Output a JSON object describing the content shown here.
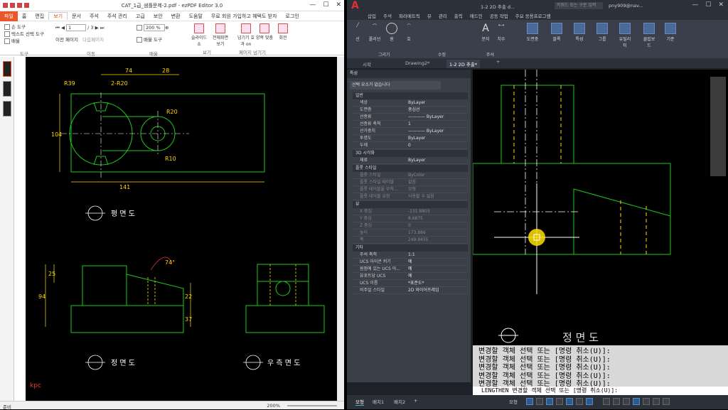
{
  "left_window": {
    "title": "CAT_1급_샘플문제-2.pdf - ezPDF Editor 3.0",
    "menu": {
      "file": "파일",
      "items": [
        "홈",
        "편집",
        "보기",
        "문서",
        "주석",
        "주석 관리",
        "고급",
        "보안",
        "변환",
        "도움말",
        "무료 회원 가입하고 혜택도 받자",
        "로그인"
      ]
    },
    "ribbon": {
      "hand": "손 도구",
      "text_select": "텍스트 선택 도구",
      "zoom_menu": "배율",
      "tools_group": "도구",
      "page_input": "1",
      "page_total": "/ 3",
      "prev_page": "이전 페이지",
      "next_page": "다음페이지",
      "move_group": "이동",
      "zoom_value": "200 %",
      "zoom_tool": "배율 도구",
      "zoom_group": "배율",
      "slideshow": "슬라이드쇼",
      "fullscreen": "전체화면 보기",
      "view_group": "보기",
      "page_view": "넘기기 효과 on",
      "page_group": "페이지 넘기기",
      "two_page": "양쪽 맞춤",
      "rotate": "회전"
    },
    "status": {
      "left": "준비",
      "zoom": "200%"
    }
  },
  "drawing_left": {
    "dims": {
      "d74": "74",
      "d28": "28",
      "r39": "R39",
      "r20a": "2-R20",
      "r20b": "R20",
      "r10": "R10",
      "d104": "104",
      "d141": "141",
      "d25": "25",
      "d94": "94",
      "d22": "22",
      "d37": "37",
      "a74": "74°"
    },
    "view_plan": "평 면 도",
    "view_front": "정 면 도",
    "view_side": "우 측 면 도",
    "logo": "kpc"
  },
  "right_window": {
    "title": "1-2 2D 추출 d...",
    "search": "키워드 또는 구문 입력",
    "user": "pny909@nav...",
    "badge": "909",
    "menu": [
      "삽입",
      "주석",
      "파라메트릭",
      "뷰",
      "관리",
      "출력",
      "애드인",
      "공동 작업",
      "주요 응용프로그램"
    ],
    "ribbon": {
      "line": "선",
      "polyline": "폴리선",
      "circle": "원",
      "arc": "호",
      "draw_group": "그리기",
      "modify_group": "수정",
      "text": "문자",
      "dimension": "치수",
      "annotate_group": "주석",
      "layer": "도면층",
      "block": "블록",
      "properties": "특성",
      "group": "그룹",
      "utilities": "유틸리티",
      "clipboard": "클립보드",
      "view": "기준"
    },
    "tabs": [
      "시작",
      "Drawing2*",
      "1-2 2D 추출*"
    ],
    "props": {
      "header": "특성",
      "selection": "선택 요소가 없습니다",
      "sections": [
        {
          "title": "일반",
          "rows": [
            [
              "색상",
              "ByLayer"
            ],
            [
              "도면층",
              "중심선"
            ],
            [
              "선종류",
              "———— ByLayer"
            ],
            [
              "선종류 축척",
              "1"
            ],
            [
              "선가중치",
              "———— ByLayer"
            ],
            [
              "투명도",
              "ByLayer"
            ],
            [
              "두께",
              "0"
            ]
          ]
        },
        {
          "title": "3D 시각화",
          "rows": [
            [
              "재료",
              "ByLayer"
            ]
          ]
        },
        {
          "title": "플롯 스타일",
          "rows": [
            [
              "플롯 스타일",
              "ByColor"
            ],
            [
              "플롯 스타일 테이블",
              "없음"
            ],
            [
              "플롯 테이블을 부착...",
              "모형"
            ],
            [
              "플롯 테이블 유형",
              "사용할 수 없음"
            ]
          ]
        },
        {
          "title": "뷰",
          "rows": [
            [
              "X 중심",
              "-131.8803"
            ],
            [
              "Y 중심",
              "8.6875"
            ],
            [
              "Z 중심",
              "0"
            ],
            [
              "높이",
              "173.886"
            ],
            [
              "폭",
              "249.9455"
            ]
          ]
        },
        {
          "title": "기타",
          "rows": [
            [
              "주석 축척",
              "1:1"
            ],
            [
              "UCS 아이콘 켜기",
              "예"
            ],
            [
              "원점에 있는 UCS 아...",
              "예"
            ],
            [
              "뷰포트당 UCS",
              "예"
            ],
            [
              "UCS 이름",
              "*표준도*"
            ],
            [
              "비주얼 스타일",
              "2D 와이어프레임"
            ]
          ]
        }
      ]
    },
    "command_history": [
      "변경할 객체 선택 또는 [명령 취소(U)]:",
      "변경할 객체 선택 또는 [명령 취소(U)]:",
      "변경할 객체 선택 또는 [명령 취소(U)]:",
      "변경할 객체 선택 또는 [명령 취소(U)]:",
      "변경할 객체 선택 또는 [명령 취소(U)]:"
    ],
    "command_prompt": "LENGTHEN 변경할 객체 선택 또는 [명령 취소(U)]:",
    "canvas_label": "정 면 도",
    "status": {
      "model": "모형",
      "layout1": "배치1",
      "layout2": "배치2",
      "mode": "모형"
    }
  }
}
